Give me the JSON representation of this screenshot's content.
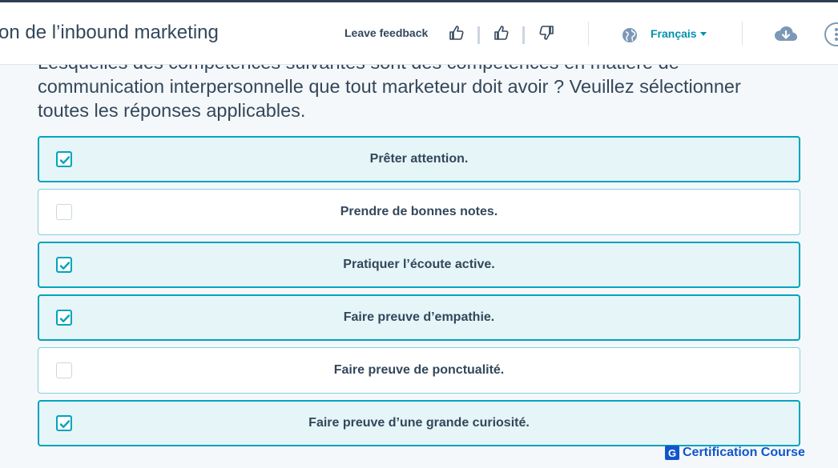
{
  "header": {
    "course_title": "on de l’inbound marketing",
    "feedback_label": "Leave feedback",
    "language": "Français"
  },
  "question": {
    "text": "Lesquelles des compétences suivantes sont des compétences en matière de communication interpersonnelle que tout marketeur doit avoir ? Veuillez sélectionner toutes les réponses applicables."
  },
  "options": [
    {
      "label": "Prêter attention.",
      "checked": true
    },
    {
      "label": "Prendre de bonnes notes.",
      "checked": false
    },
    {
      "label": "Pratiquer l’écoute active.",
      "checked": true
    },
    {
      "label": "Faire preuve d’empathie.",
      "checked": true
    },
    {
      "label": "Faire preuve de ponctualité.",
      "checked": false
    },
    {
      "label": "Faire preuve d’une grande curiosité.",
      "checked": true
    }
  ],
  "watermark": {
    "letter": "G",
    "text": "Certification Course"
  },
  "colors": {
    "accent": "#00a4bd",
    "link": "#0091ae",
    "text": "#33475b"
  },
  "icons": [
    "thumbs-up-outline-icon",
    "thumbs-up-icon",
    "thumbs-down-icon",
    "globe-icon",
    "cloud-download-icon",
    "more-options-icon",
    "checkmark-icon"
  ]
}
